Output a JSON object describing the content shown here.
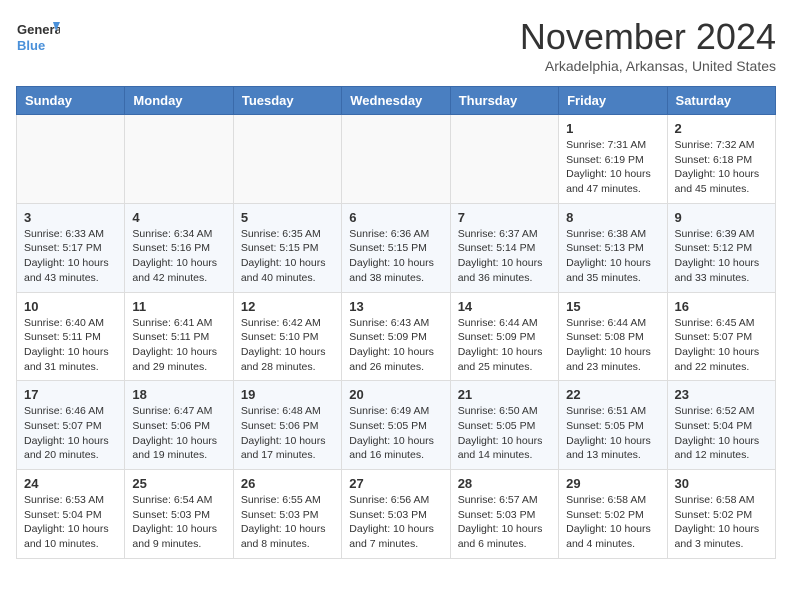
{
  "logo": {
    "line1": "General",
    "line2": "Blue"
  },
  "title": "November 2024",
  "location": "Arkadelphia, Arkansas, United States",
  "weekdays": [
    "Sunday",
    "Monday",
    "Tuesday",
    "Wednesday",
    "Thursday",
    "Friday",
    "Saturday"
  ],
  "weeks": [
    [
      {
        "day": "",
        "info": ""
      },
      {
        "day": "",
        "info": ""
      },
      {
        "day": "",
        "info": ""
      },
      {
        "day": "",
        "info": ""
      },
      {
        "day": "",
        "info": ""
      },
      {
        "day": "1",
        "info": "Sunrise: 7:31 AM\nSunset: 6:19 PM\nDaylight: 10 hours and 47 minutes."
      },
      {
        "day": "2",
        "info": "Sunrise: 7:32 AM\nSunset: 6:18 PM\nDaylight: 10 hours and 45 minutes."
      }
    ],
    [
      {
        "day": "3",
        "info": "Sunrise: 6:33 AM\nSunset: 5:17 PM\nDaylight: 10 hours and 43 minutes."
      },
      {
        "day": "4",
        "info": "Sunrise: 6:34 AM\nSunset: 5:16 PM\nDaylight: 10 hours and 42 minutes."
      },
      {
        "day": "5",
        "info": "Sunrise: 6:35 AM\nSunset: 5:15 PM\nDaylight: 10 hours and 40 minutes."
      },
      {
        "day": "6",
        "info": "Sunrise: 6:36 AM\nSunset: 5:15 PM\nDaylight: 10 hours and 38 minutes."
      },
      {
        "day": "7",
        "info": "Sunrise: 6:37 AM\nSunset: 5:14 PM\nDaylight: 10 hours and 36 minutes."
      },
      {
        "day": "8",
        "info": "Sunrise: 6:38 AM\nSunset: 5:13 PM\nDaylight: 10 hours and 35 minutes."
      },
      {
        "day": "9",
        "info": "Sunrise: 6:39 AM\nSunset: 5:12 PM\nDaylight: 10 hours and 33 minutes."
      }
    ],
    [
      {
        "day": "10",
        "info": "Sunrise: 6:40 AM\nSunset: 5:11 PM\nDaylight: 10 hours and 31 minutes."
      },
      {
        "day": "11",
        "info": "Sunrise: 6:41 AM\nSunset: 5:11 PM\nDaylight: 10 hours and 29 minutes."
      },
      {
        "day": "12",
        "info": "Sunrise: 6:42 AM\nSunset: 5:10 PM\nDaylight: 10 hours and 28 minutes."
      },
      {
        "day": "13",
        "info": "Sunrise: 6:43 AM\nSunset: 5:09 PM\nDaylight: 10 hours and 26 minutes."
      },
      {
        "day": "14",
        "info": "Sunrise: 6:44 AM\nSunset: 5:09 PM\nDaylight: 10 hours and 25 minutes."
      },
      {
        "day": "15",
        "info": "Sunrise: 6:44 AM\nSunset: 5:08 PM\nDaylight: 10 hours and 23 minutes."
      },
      {
        "day": "16",
        "info": "Sunrise: 6:45 AM\nSunset: 5:07 PM\nDaylight: 10 hours and 22 minutes."
      }
    ],
    [
      {
        "day": "17",
        "info": "Sunrise: 6:46 AM\nSunset: 5:07 PM\nDaylight: 10 hours and 20 minutes."
      },
      {
        "day": "18",
        "info": "Sunrise: 6:47 AM\nSunset: 5:06 PM\nDaylight: 10 hours and 19 minutes."
      },
      {
        "day": "19",
        "info": "Sunrise: 6:48 AM\nSunset: 5:06 PM\nDaylight: 10 hours and 17 minutes."
      },
      {
        "day": "20",
        "info": "Sunrise: 6:49 AM\nSunset: 5:05 PM\nDaylight: 10 hours and 16 minutes."
      },
      {
        "day": "21",
        "info": "Sunrise: 6:50 AM\nSunset: 5:05 PM\nDaylight: 10 hours and 14 minutes."
      },
      {
        "day": "22",
        "info": "Sunrise: 6:51 AM\nSunset: 5:05 PM\nDaylight: 10 hours and 13 minutes."
      },
      {
        "day": "23",
        "info": "Sunrise: 6:52 AM\nSunset: 5:04 PM\nDaylight: 10 hours and 12 minutes."
      }
    ],
    [
      {
        "day": "24",
        "info": "Sunrise: 6:53 AM\nSunset: 5:04 PM\nDaylight: 10 hours and 10 minutes."
      },
      {
        "day": "25",
        "info": "Sunrise: 6:54 AM\nSunset: 5:03 PM\nDaylight: 10 hours and 9 minutes."
      },
      {
        "day": "26",
        "info": "Sunrise: 6:55 AM\nSunset: 5:03 PM\nDaylight: 10 hours and 8 minutes."
      },
      {
        "day": "27",
        "info": "Sunrise: 6:56 AM\nSunset: 5:03 PM\nDaylight: 10 hours and 7 minutes."
      },
      {
        "day": "28",
        "info": "Sunrise: 6:57 AM\nSunset: 5:03 PM\nDaylight: 10 hours and 6 minutes."
      },
      {
        "day": "29",
        "info": "Sunrise: 6:58 AM\nSunset: 5:02 PM\nDaylight: 10 hours and 4 minutes."
      },
      {
        "day": "30",
        "info": "Sunrise: 6:58 AM\nSunset: 5:02 PM\nDaylight: 10 hours and 3 minutes."
      }
    ]
  ]
}
